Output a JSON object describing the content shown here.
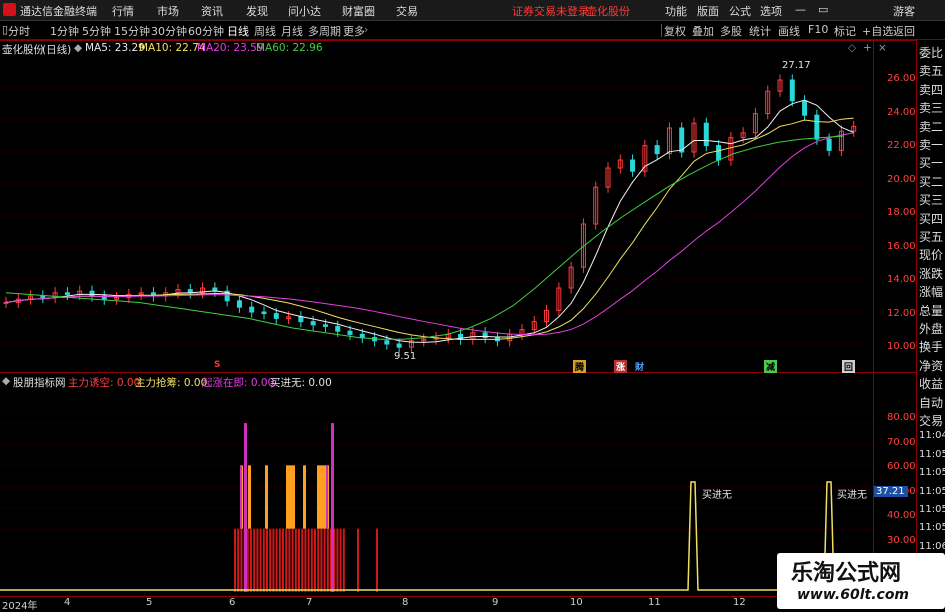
{
  "app": {
    "title": "通达信金融终端",
    "notice": "证券交易未登录",
    "stock_tag": "壶化股份",
    "guest": "游客"
  },
  "menu": {
    "items": [
      "行情",
      "市场",
      "资讯",
      "发现",
      "问小达",
      "财富圈",
      "交易"
    ],
    "right": [
      "功能",
      "版面",
      "公式",
      "选项"
    ]
  },
  "periods": [
    "分时",
    "1分钟",
    "5分钟",
    "15分钟",
    "30分钟",
    "60分钟",
    "日线",
    "周线",
    "月线",
    "多周期",
    "更多"
  ],
  "active_period": "日线",
  "tools": [
    "复权",
    "叠加",
    "多股",
    "统计",
    "画线",
    "F10",
    "标记",
    "+自选",
    "返回"
  ],
  "main_chart": {
    "stock_name": "壶化股份",
    "period_label": "(日线)",
    "ma5": "MA5: 23.29",
    "ma10": "MA10: 22.74",
    "ma20": "MA20: 23.59",
    "ma60": "MA60: 22.96",
    "high_label": "27.17",
    "low_label": "9.51"
  },
  "sub_chart": {
    "name": "股朋指标网",
    "l1": "主力诱空: 0.00",
    "l2": "主力抢筹: 0.00",
    "l3": "起涨在即: 0.00",
    "l4": "买进无: 0.00",
    "tag": "买进无",
    "badge": "37.21"
  },
  "price_axis": [
    "26.00",
    "24.00",
    "22.00",
    "20.00",
    "18.00",
    "16.00",
    "14.00",
    "12.00",
    "10.00"
  ],
  "sub_axis": [
    "80.00",
    "70.00",
    "60.00",
    "50.00",
    "40.00",
    "30.00",
    "20.00"
  ],
  "date_axis": [
    "2024年",
    "4",
    "5",
    "6",
    "7",
    "8",
    "9",
    "10",
    "11",
    "12"
  ],
  "events": [
    {
      "t": "S",
      "c": "#ff3333"
    },
    {
      "t": "腾",
      "c": "#d9a020"
    },
    {
      "t": "涨",
      "c": "#ff5050"
    },
    {
      "t": "财",
      "c": "#4ea0ff"
    },
    {
      "t": "减",
      "c": "#50c850"
    },
    {
      "t": "回",
      "c": "#d0d0d0"
    }
  ],
  "side_panel": [
    "委比",
    "卖五",
    "卖四",
    "卖三",
    "卖二",
    "卖一",
    "买一",
    "买二",
    "买三",
    "买四",
    "买五",
    "现价",
    "涨跌",
    "涨幅",
    "总量",
    "外盘",
    "换手",
    "净资",
    "收益",
    "自动",
    "交易",
    "11:04",
    "11:05",
    "11:05",
    "11:05",
    "11:05",
    "11:05",
    "11:06",
    "11:06",
    "11:06",
    "11:06"
  ],
  "watermark": {
    "title": "乐淘公式网",
    "url": "www.60lt.com"
  },
  "chart_data": {
    "type": "candlestick",
    "x_range": [
      "2024-01",
      "2024-12"
    ],
    "price_range": [
      9.0,
      27.5
    ],
    "close": [
      12.6,
      12.8,
      13.0,
      12.9,
      13.2,
      13.1,
      13.3,
      13.0,
      12.8,
      12.9,
      13.1,
      13.2,
      13.0,
      13.2,
      13.4,
      13.2,
      13.5,
      13.3,
      12.7,
      12.3,
      12.0,
      11.9,
      11.6,
      11.7,
      11.4,
      11.2,
      11.1,
      10.8,
      10.6,
      10.4,
      10.2,
      10.0,
      9.8,
      10.2,
      10.3,
      10.4,
      10.6,
      10.3,
      10.7,
      10.4,
      10.2,
      10.6,
      10.9,
      11.4,
      12.1,
      13.5,
      14.8,
      17.5,
      19.8,
      21.0,
      21.5,
      20.8,
      22.4,
      21.9,
      23.5,
      22.0,
      23.8,
      22.4,
      21.5,
      22.9,
      23.2,
      24.4,
      25.8,
      26.5,
      25.2,
      24.3,
      22.8,
      22.1,
      23.3,
      23.6
    ],
    "ma60": [
      13.2,
      13.1,
      13.0,
      12.9,
      12.8,
      12.7,
      12.6,
      12.4,
      12.2,
      12.0,
      11.8,
      11.6,
      11.3,
      11.0,
      10.8,
      10.6,
      10.4,
      10.3,
      10.3,
      10.4,
      10.6,
      11.0,
      11.6,
      12.4,
      13.5,
      14.7,
      15.9,
      17.0,
      18.0,
      18.9,
      19.8,
      20.6,
      21.3,
      21.9,
      22.3,
      22.6,
      22.8,
      22.9,
      23.0
    ],
    "bars": [
      {
        "x": 0.5,
        "v": 30
      },
      {
        "x": 0.52,
        "v": 60
      },
      {
        "x": 0.6,
        "v": 80
      }
    ]
  }
}
